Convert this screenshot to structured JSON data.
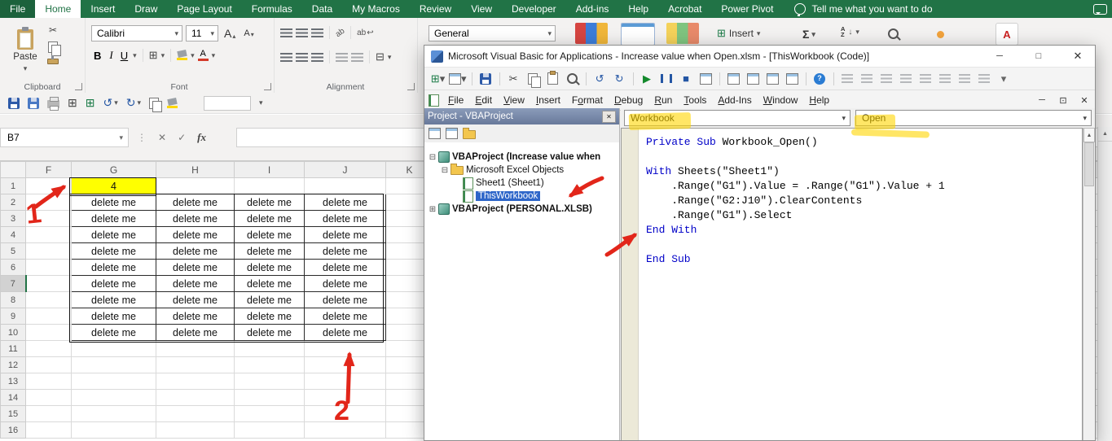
{
  "colors": {
    "excel_green": "#217346",
    "highlight_yellow": "#ffff00",
    "annotation_red": "#e2261a",
    "keyword_blue": "#0000c8",
    "selection_blue": "#2e66c9"
  },
  "icons": {
    "chevron-down": "▾",
    "chevron-up": "▴",
    "triangle-up": "▲",
    "close": "✕",
    "minimize": "─",
    "maximize": "□",
    "restore": "⊡",
    "check": "✓",
    "x-mark": "✕",
    "scissors": "✂",
    "undo": "↺",
    "redo": "↻",
    "grid": "⊞",
    "tree-minus": "⊟",
    "tree-plus": "⊞",
    "sum": "Σ",
    "play": "▶",
    "stop": "■",
    "question": "?",
    "dots": "⋮",
    "letter-a": "A",
    "letter-z": "Z",
    "arrow-down": "↓",
    "ab": "ab",
    "wrap-return": "↩"
  },
  "excel": {
    "tabs": [
      "File",
      "Home",
      "Insert",
      "Draw",
      "Page Layout",
      "Formulas",
      "Data",
      "My Macros",
      "Review",
      "View",
      "Developer",
      "Add-ins",
      "Help",
      "Acrobat",
      "Power Pivot"
    ],
    "active_tab": "Home",
    "tell_me": "Tell me what you want to do",
    "ribbon": {
      "paste_label": "Paste",
      "font_name": "Calibri",
      "font_size": "11",
      "bold": "B",
      "italic": "I",
      "underline": "U",
      "number_format": "General",
      "insert_label": "Insert",
      "groups": {
        "clipboard": "Clipboard",
        "font": "Font",
        "alignment": "Alignment"
      }
    },
    "formula_bar": {
      "name_box": "B7",
      "fx": "fx"
    },
    "sheet": {
      "columns": [
        "F",
        "G",
        "H",
        "I",
        "J",
        "K",
        ""
      ],
      "rows": [
        "1",
        "2",
        "3",
        "4",
        "5",
        "6",
        "7",
        "8",
        "9",
        "10",
        "11",
        "12",
        "13",
        "14",
        "15",
        "16"
      ],
      "active_row": "7",
      "g1_value": "4",
      "fill_text": "delete me",
      "filled_columns": [
        "G",
        "H",
        "I",
        "J"
      ],
      "filled_row_start": 2,
      "filled_row_end": 10
    }
  },
  "vba": {
    "title": "Microsoft Visual Basic for Applications - Increase value when Open.xlsm - [ThisWorkbook (Code)]",
    "menus": [
      {
        "label": "File",
        "u": 0
      },
      {
        "label": "Edit",
        "u": 0
      },
      {
        "label": "View",
        "u": 0
      },
      {
        "label": "Insert",
        "u": 0
      },
      {
        "label": "Format",
        "u": 1
      },
      {
        "label": "Debug",
        "u": 0
      },
      {
        "label": "Run",
        "u": 0
      },
      {
        "label": "Tools",
        "u": 0
      },
      {
        "label": "Add-Ins",
        "u": 0
      },
      {
        "label": "Window",
        "u": 0
      },
      {
        "label": "Help",
        "u": 0
      }
    ],
    "toolbar": [
      {
        "name": "view-excel-button",
        "icon": "grid",
        "color": "#1a7a46",
        "chev": true
      },
      {
        "name": "insert-object-button",
        "cls": "winicon",
        "chev": true
      },
      {
        "sep": true
      },
      {
        "name": "save-button",
        "cls": "i-floppy"
      },
      {
        "sep": true
      },
      {
        "name": "cut-button",
        "icon": "scissors",
        "color": "#444444"
      },
      {
        "name": "copy-button",
        "cls": "i-copy"
      },
      {
        "name": "paste-button",
        "cls": "i-clipp"
      },
      {
        "name": "find-button",
        "cls": "i-mag"
      },
      {
        "sep": true
      },
      {
        "name": "undo-button",
        "icon": "undo",
        "color": "#2456a4"
      },
      {
        "name": "redo-button",
        "icon": "redo",
        "color": "#2456a4"
      },
      {
        "sep": true
      },
      {
        "name": "run-button",
        "icon": "play",
        "color": "#14892c"
      },
      {
        "name": "break-button",
        "cls": "i-pause"
      },
      {
        "name": "reset-button",
        "icon": "stop",
        "color": "#2456a4"
      },
      {
        "name": "design-mode-button",
        "cls": "winicon"
      },
      {
        "sep": true
      },
      {
        "name": "project-explorer-button",
        "cls": "winicon"
      },
      {
        "name": "properties-window-button",
        "cls": "winicon"
      },
      {
        "name": "object-browser-button",
        "cls": "winicon"
      },
      {
        "name": "toolbox-button",
        "cls": "winicon"
      },
      {
        "sep": true
      },
      {
        "name": "help-button",
        "cls": "i-help",
        "icon": "question"
      },
      {
        "sep": true
      },
      {
        "name": "edit-toolbar-button-1",
        "cls": "ic-bars dim"
      },
      {
        "name": "edit-toolbar-button-2",
        "cls": "ic-bars dim"
      },
      {
        "name": "edit-toolbar-button-3",
        "cls": "ic-bars dim"
      },
      {
        "name": "edit-toolbar-button-4",
        "cls": "ic-bars dim"
      },
      {
        "name": "edit-toolbar-button-5",
        "cls": "ic-bars dim"
      },
      {
        "name": "edit-toolbar-button-6",
        "cls": "ic-bars dim"
      },
      {
        "name": "edit-toolbar-button-7",
        "cls": "ic-bars dim"
      },
      {
        "name": "edit-toolbar-button-8",
        "cls": "ic-bars dim"
      },
      {
        "name": "toolbar-options-button",
        "icon": "chevron-down",
        "color": "#666666"
      }
    ],
    "project": {
      "header": "Project - VBAProject",
      "tree": [
        {
          "label": "VBAProject (Increase value when",
          "bold": true,
          "expander": "minus",
          "icon": "project"
        },
        {
          "label": "Microsoft Excel Objects",
          "indent": 1,
          "expander": "minus",
          "icon": "folder"
        },
        {
          "label": "Sheet1 (Sheet1)",
          "indent": 2,
          "icon": "sheet"
        },
        {
          "label": "ThisWorkbook",
          "indent": 2,
          "icon": "workbook",
          "selected": true
        },
        {
          "label": "VBAProject (PERSONAL.XLSB)",
          "bold": true,
          "expander": "plus",
          "icon": "project"
        }
      ]
    },
    "code": {
      "object_dropdown": "Workbook",
      "event_dropdown": "Open",
      "lines": [
        [
          {
            "k": "Private Sub "
          },
          {
            "t": "Workbook_Open()"
          }
        ],
        [],
        [
          {
            "k": "With "
          },
          {
            "t": "Sheets(\"Sheet1\")"
          }
        ],
        [
          {
            "t": "    .Range(\"G1\").Value = .Range(\"G1\").Value + 1"
          }
        ],
        [
          {
            "t": "    .Range(\"G2:J10\").ClearContents"
          }
        ],
        [
          {
            "t": "    .Range(\"G1\").Select"
          }
        ],
        [
          {
            "k": "End With"
          }
        ],
        [],
        [
          {
            "k": "End Sub"
          }
        ]
      ]
    }
  },
  "annotations": {
    "digit1": "1",
    "digit2": "2"
  }
}
